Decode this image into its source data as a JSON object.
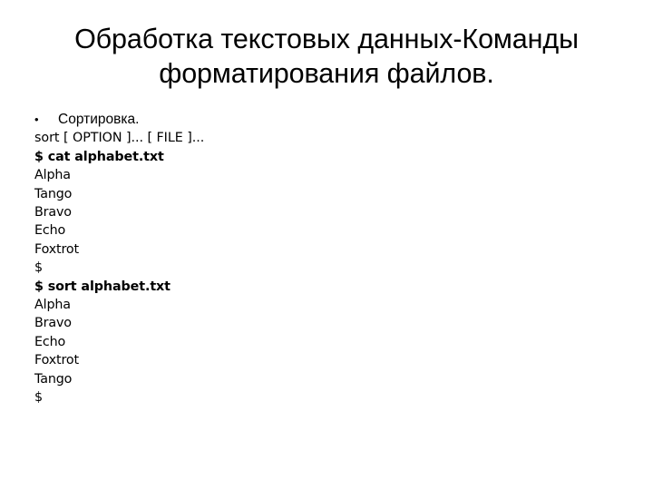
{
  "slide": {
    "title": "Обработка текстовых данных-Команды форматирования файлов.",
    "background_color": "#FFFFFF",
    "text_color": "#000000"
  },
  "body": {
    "bullet_marker": "•",
    "bullet_text": "Сортировка.",
    "lines": [
      {
        "text": "sort [ OPTION ]... [ FILE ]...",
        "bold": false
      },
      {
        "text": "$ cat alphabet.txt",
        "bold": true
      },
      {
        "text": "Alpha",
        "bold": false
      },
      {
        "text": "Tango",
        "bold": false
      },
      {
        "text": "Bravo",
        "bold": false
      },
      {
        "text": "Echo",
        "bold": false
      },
      {
        "text": "Foxtrot",
        "bold": false
      },
      {
        "text": "$",
        "bold": false
      },
      {
        "text": "$ sort alphabet.txt",
        "bold": true
      },
      {
        "text": "Alpha",
        "bold": false
      },
      {
        "text": "Bravo",
        "bold": false
      },
      {
        "text": "Echo",
        "bold": false
      },
      {
        "text": "Foxtrot",
        "bold": false
      },
      {
        "text": "Tango",
        "bold": false
      },
      {
        "text": "$",
        "bold": false
      }
    ]
  }
}
